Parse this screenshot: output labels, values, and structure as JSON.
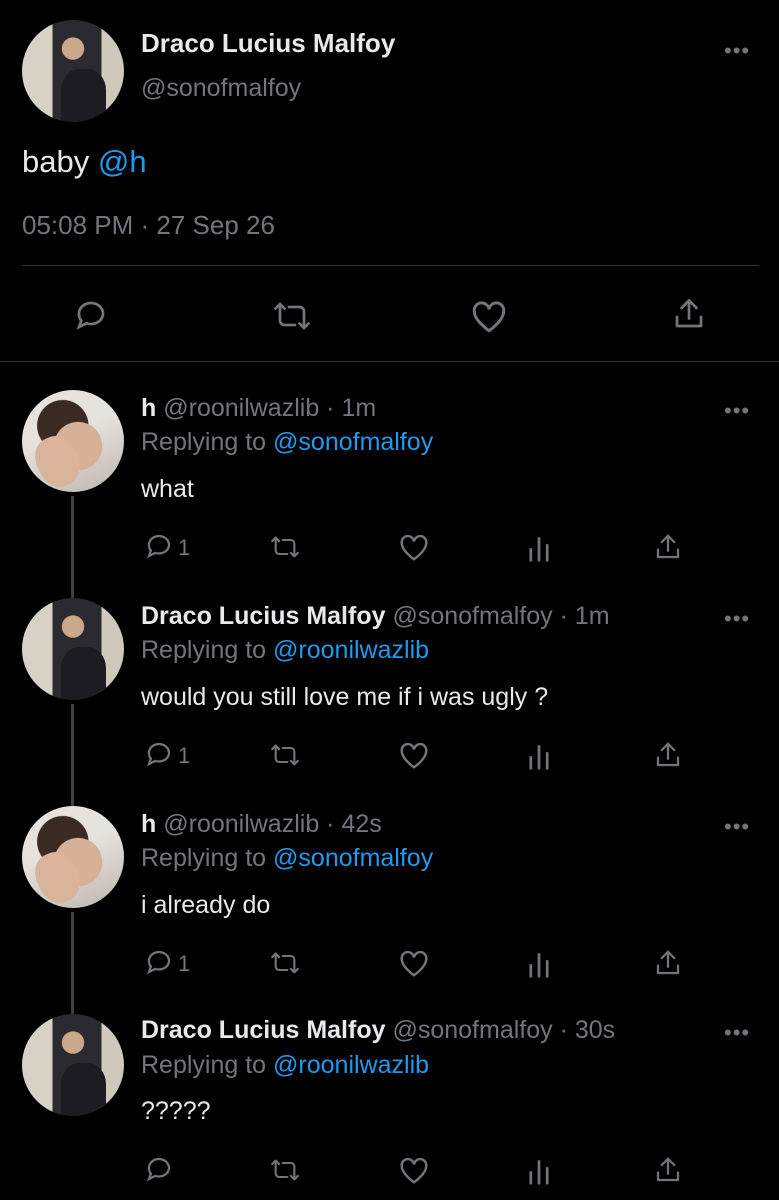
{
  "main_tweet": {
    "display_name": "Draco Lucius Malfoy",
    "handle": "@sonofmalfoy",
    "text_prefix": "baby ",
    "mention": "@h",
    "timestamp": "05:08 PM · 27 Sep 26"
  },
  "replies": [
    {
      "display_name": "h",
      "handle_time": "@roonilwazlib · 1m",
      "replying_prefix": "Replying to ",
      "replying_to": "@sonofmalfoy",
      "text": "what",
      "reply_count": "1"
    },
    {
      "display_name": "Draco Lucius Malfoy",
      "handle_time": "@sonofmalfoy · 1m",
      "replying_prefix": "Replying to ",
      "replying_to": "@roonilwazlib",
      "text": "would you still love me if i was ugly ?",
      "reply_count": "1"
    },
    {
      "display_name": "h",
      "handle_time": "@roonilwazlib · 42s",
      "replying_prefix": "Replying to ",
      "replying_to": "@sonofmalfoy",
      "text": "i already do",
      "reply_count": "1"
    },
    {
      "display_name": "Draco Lucius Malfoy",
      "handle_time": "@sonofmalfoy · 30s",
      "replying_prefix": "Replying to ",
      "replying_to": "@roonilwazlib",
      "text": "?????",
      "reply_count": ""
    }
  ],
  "colors": {
    "background": "#000000",
    "text": "#e7e9ea",
    "muted": "#71767b",
    "link": "#1d9bf0"
  },
  "icons": [
    "more-icon",
    "reply-icon",
    "retweet-icon",
    "like-icon",
    "share-icon",
    "views-icon"
  ]
}
